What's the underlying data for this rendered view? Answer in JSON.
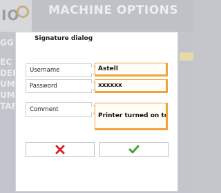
{
  "app": {
    "title": "MACHINE OPTIONS",
    "logo_text": "IO",
    "menu_fragments": [
      "GG",
      "EC",
      "DER",
      "UM",
      "UME",
      "TAF"
    ]
  },
  "dialog": {
    "title": "Signature dialog",
    "fields": [
      {
        "label": "Username",
        "value": "Astell"
      },
      {
        "label": "Password",
        "value": "xxxxxx"
      },
      {
        "label": "Comment",
        "value": "Printer turned on to ..."
      }
    ],
    "buttons": {
      "cancel_icon": "cross-icon",
      "confirm_icon": "checkmark-icon",
      "cancel_color": "#d8232a",
      "confirm_color": "#3aa53a"
    },
    "accent_color": "#f0a33a"
  }
}
